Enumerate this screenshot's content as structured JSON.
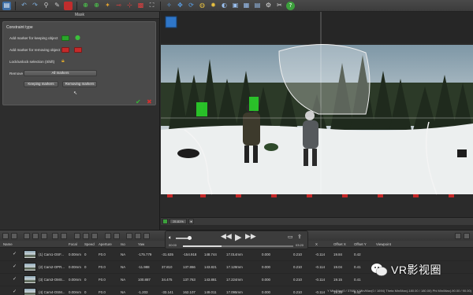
{
  "mask_panel": {
    "title": "Mask",
    "section_title": "Constraint type",
    "keep_label": "Add marker for keeping object",
    "remove_label": "Add marker for removing object",
    "lock_label": "Lock/unlock selection (Shift)",
    "remove_row_label": "Remove",
    "dropdown_value": "All markers",
    "keeping_button": "Keeping markers",
    "removing_button": "Removing markers"
  },
  "viewer": {
    "zoom": "25.81%"
  },
  "media": {
    "time_start": "00:00",
    "time_end": "03:20",
    "progress": 0.35
  },
  "table": {
    "headers": [
      "Name",
      "Focal",
      "Speed",
      "Aperture",
      "Iso",
      "Yaw",
      "Pitch",
      "Roll",
      "",
      "",
      "",
      "",
      "X",
      "Offset X",
      "Offset Y",
      "Viewpoint"
    ],
    "rows": [
      [
        "(1) Cam1-OSF...",
        "0.00mm",
        "0",
        "F0.0",
        "NA",
        "-175.779",
        "-31.635",
        "-154.918",
        "148.744",
        "17.014mm",
        "0.000",
        "0.210",
        "-0.114",
        "19.84",
        "0.42"
      ],
      [
        "(2) Cam2-OPR...",
        "0.00mm",
        "0",
        "F0.0",
        "NA",
        "-11.988",
        "37.810",
        "137.866",
        "143.821",
        "17.128mm",
        "0.000",
        "0.210",
        "-0.114",
        "19.04",
        "0.41"
      ],
      [
        "(3) Cam3-OMS...",
        "0.00mm",
        "0",
        "F0.0",
        "NA",
        "100.887",
        "34.475",
        "137.763",
        "143.881",
        "17.224mm",
        "0.000",
        "0.210",
        "-0.114",
        "19.15",
        "0.41"
      ],
      [
        "(4) Cam4-OSM...",
        "0.00mm",
        "0",
        "F0.0",
        "NA",
        "-1.203",
        "-33.141",
        "162.107",
        "149.011",
        "17.095mm",
        "0.000",
        "0.210",
        "-0.114",
        "19.28",
        "0.42"
      ]
    ]
  },
  "status_bar": {
    "text": "Y Min/Max(0 / 3768)    X Min/Max(0 / 1694)    Theta Min/Max(-180.00 / 180.00)    Phi Min/Max(-90.00 / 90.00)"
  },
  "watermark": {
    "text": "VR影视圈"
  },
  "colors": {
    "keep_green": "#2aa52a",
    "remove_red": "#c42a2a",
    "accept_green": "#35b535",
    "reject_red": "#d23030"
  }
}
